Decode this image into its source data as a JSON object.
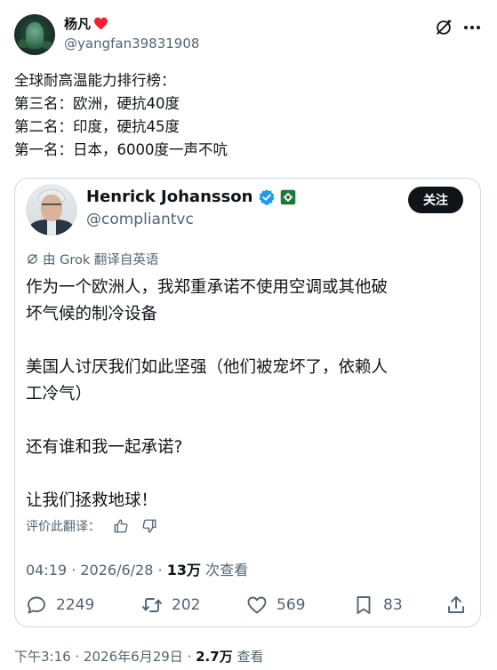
{
  "post": {
    "author_name": "杨凡",
    "author_handle": "@yangfan39831908",
    "lines": [
      "全球耐高温能力排行榜：",
      "第三名：欧洲，硬抗40度",
      "第二名：印度，硬抗45度",
      "第一名：日本，6000度一声不吭"
    ],
    "time": "下午3:16",
    "date": "2026年6月29日",
    "views_count": "2.7万",
    "views_label": "查看"
  },
  "quote": {
    "name": "Henrick Johansson",
    "handle": "@compliantvc",
    "follow_label": "关注",
    "translated_label": "由 Grok 翻译自英语",
    "paragraphs": [
      [
        "作为一个欧洲人，我郑重承诺不使用空调或其他破",
        "坏气候的制冷设备"
      ],
      [
        "美国人讨厌我们如此坚强（他们被宠坏了，依赖人",
        "工冷气）"
      ],
      [
        "还有谁和我一起承诺?"
      ],
      [
        "让我们拯救地球！"
      ]
    ],
    "rate_label": "评价此翻译：",
    "time": "04:19",
    "date": "2026/6/28",
    "views_count": "13万",
    "views_label": "次查看",
    "replies": "2249",
    "reposts": "202",
    "likes": "569",
    "bookmarks": "83"
  },
  "icons": {
    "heart": "heart-icon",
    "grok": "grok-icon",
    "more": "more-icon",
    "verified": "verified-icon",
    "affiliate": "affiliate-icon",
    "reply": "reply-icon",
    "repost": "repost-icon",
    "like": "like-icon",
    "bookmark": "bookmark-icon",
    "share": "share-icon"
  },
  "colors": {
    "text": "#0f1419",
    "secondary": "#536471",
    "verified": "#1d9bf0",
    "heart": "#f4212e",
    "border": "#cfd9de"
  }
}
